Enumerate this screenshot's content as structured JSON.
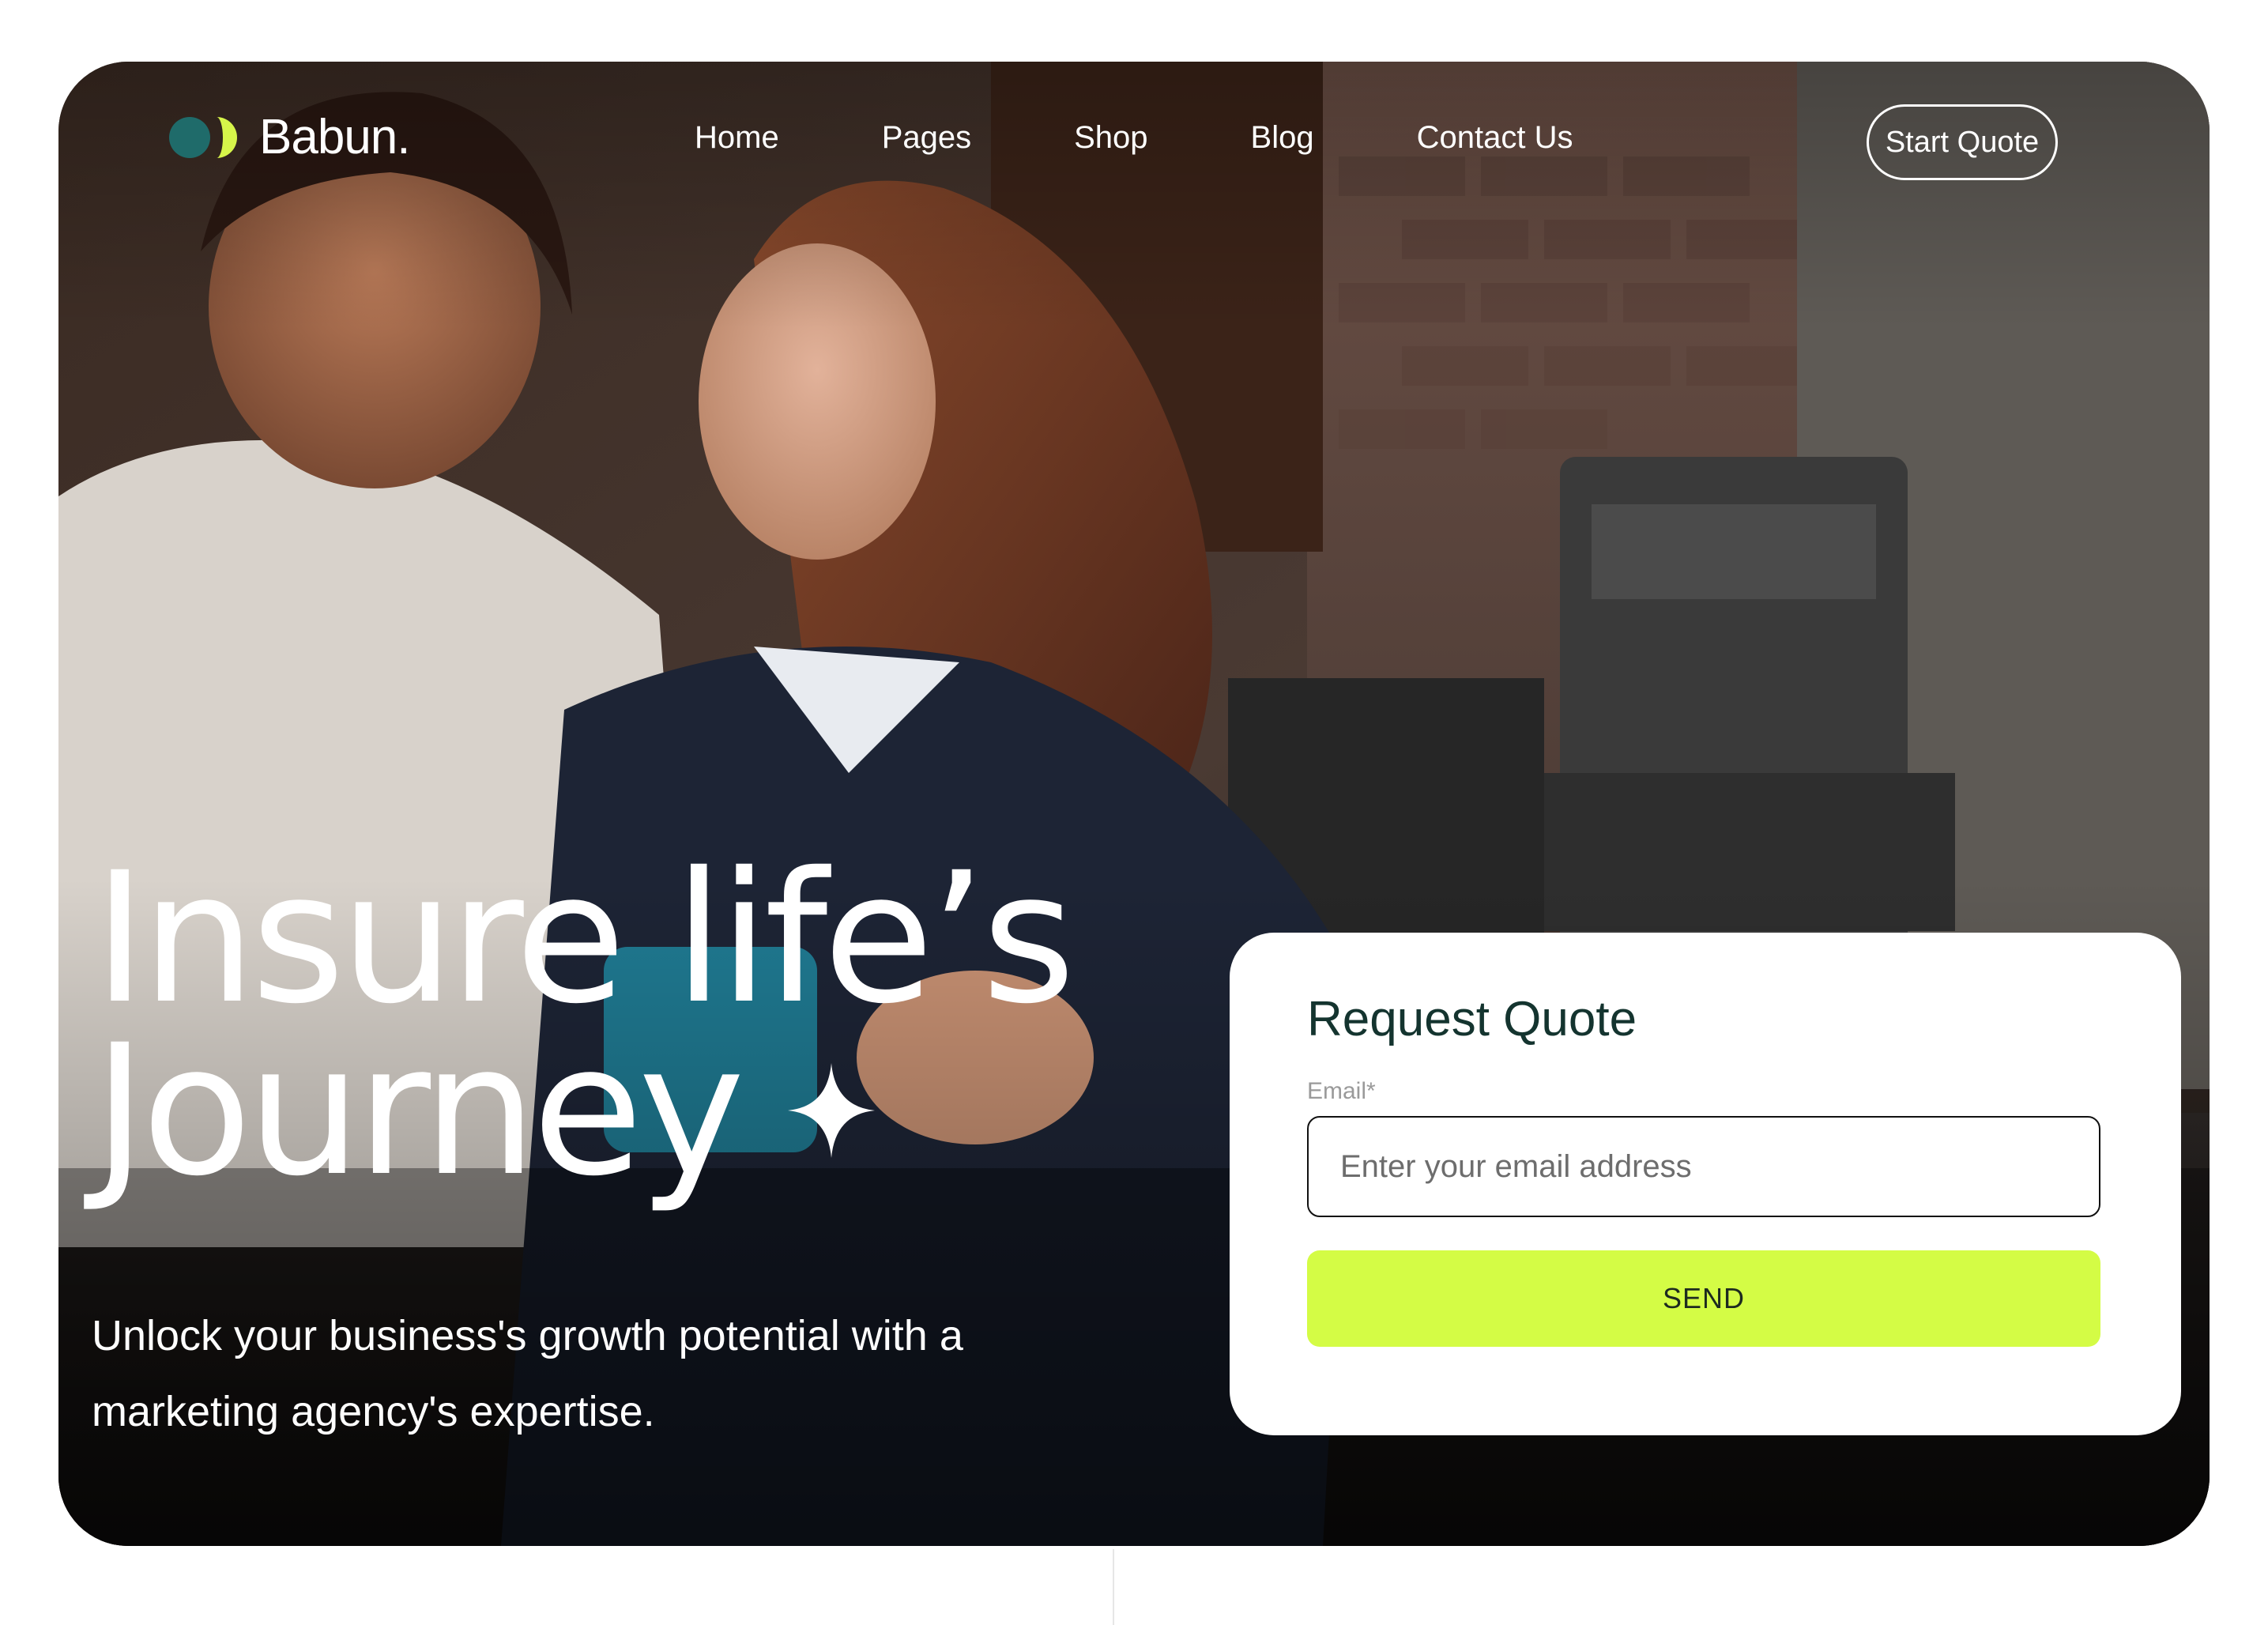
{
  "brand": {
    "name": "Babun.",
    "colors": {
      "mark_primary": "#1f6b6a",
      "mark_accent": "#d6f54a"
    }
  },
  "nav": {
    "items": [
      "Home",
      "Pages",
      "Shop",
      "Blog",
      "Contact Us"
    ],
    "cta_label": "Start Quote"
  },
  "hero": {
    "headline_line1": "Insure life’s",
    "headline_line2": "Journey",
    "subtitle": "Unlock your business's growth potential with a marketing agency's expertise.",
    "image": "two-women-smiling-coffee-shop-photo"
  },
  "quote_form": {
    "title": "Request Quote",
    "email_label": "Email*",
    "email_placeholder": "Enter your email address",
    "email_value": "",
    "submit_label": "SEND",
    "colors": {
      "submit_bg": "#d4fc45",
      "title": "#14342f"
    }
  },
  "icons": [
    "logo-mark-icon",
    "sparkle-icon"
  ]
}
